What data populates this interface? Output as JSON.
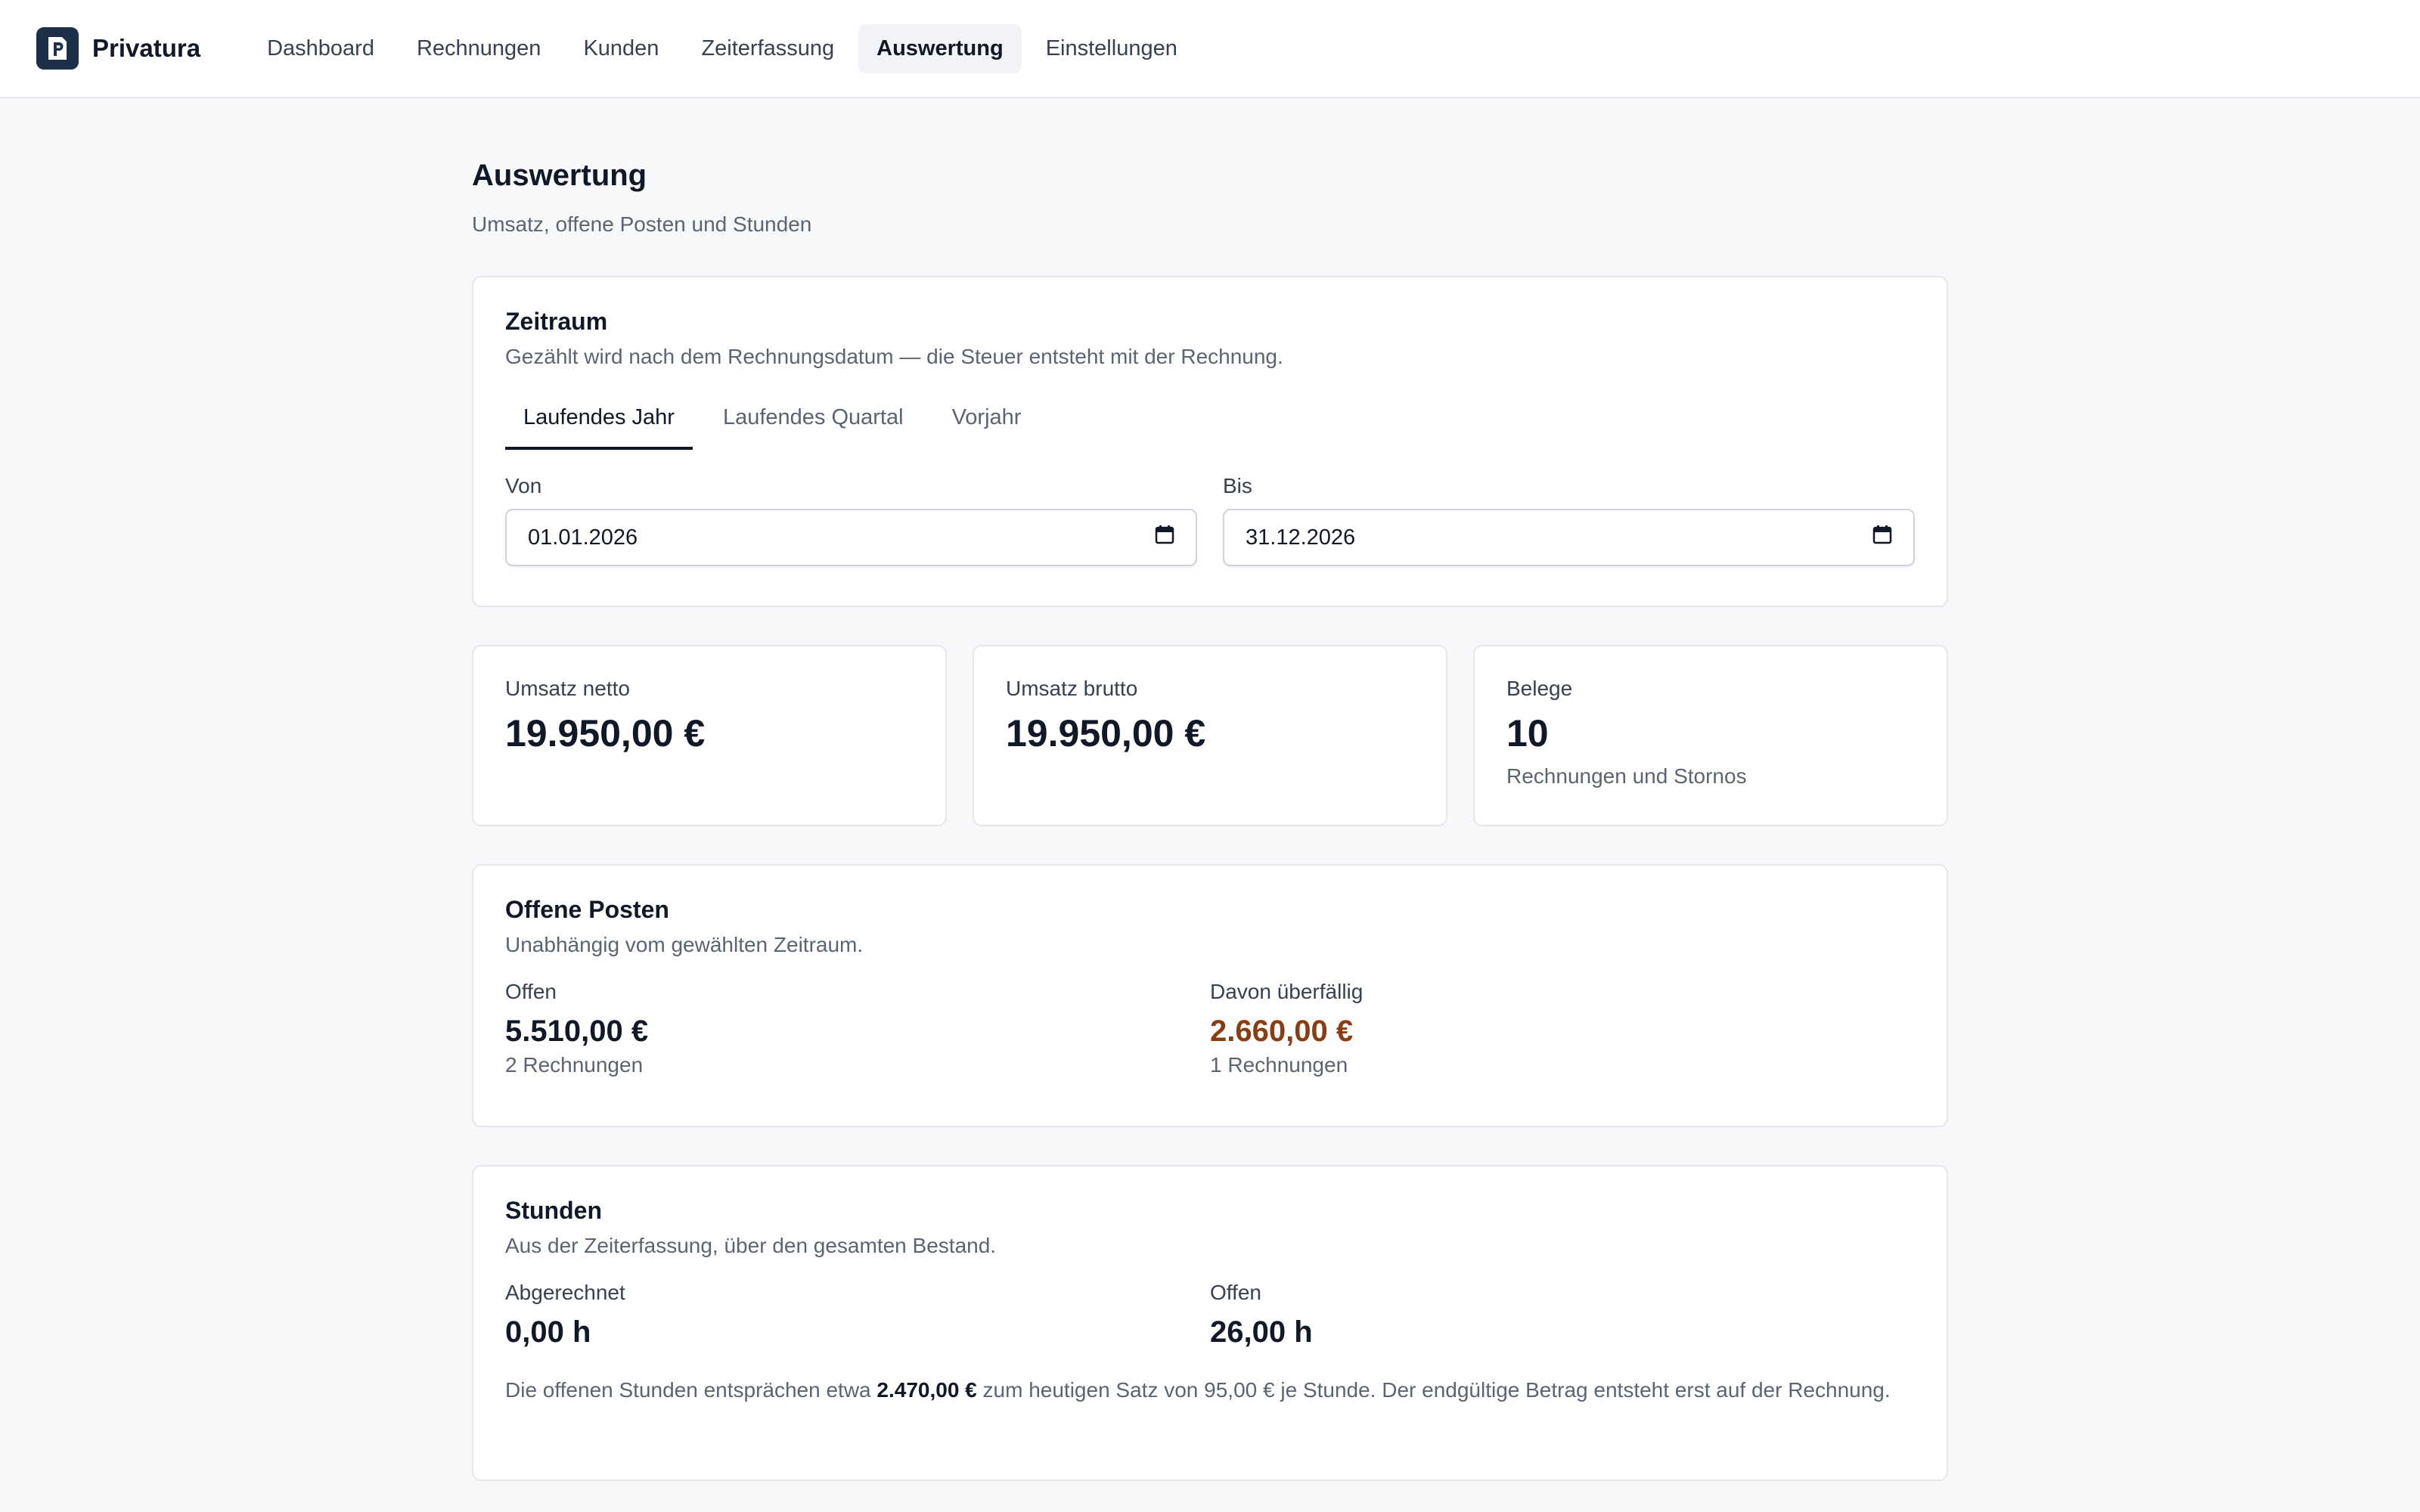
{
  "app": {
    "name": "Privatura",
    "logo_icon": "document-p-icon"
  },
  "nav": {
    "items": [
      {
        "label": "Dashboard",
        "active": false
      },
      {
        "label": "Rechnungen",
        "active": false
      },
      {
        "label": "Kunden",
        "active": false
      },
      {
        "label": "Zeiterfassung",
        "active": false
      },
      {
        "label": "Auswertung",
        "active": true
      },
      {
        "label": "Einstellungen",
        "active": false
      }
    ]
  },
  "page": {
    "title": "Auswertung",
    "subtitle": "Umsatz, offene Posten und Stunden"
  },
  "zeitraum": {
    "title": "Zeitraum",
    "subtitle": "Gezählt wird nach dem Rechnungsdatum — die Steuer entsteht mit der Rechnung.",
    "tabs": [
      {
        "label": "Laufendes Jahr",
        "active": true
      },
      {
        "label": "Laufendes Quartal",
        "active": false
      },
      {
        "label": "Vorjahr",
        "active": false
      }
    ],
    "von_label": "Von",
    "von_value": "01.01.2026",
    "bis_label": "Bis",
    "bis_value": "31.12.2026"
  },
  "stats": {
    "netto": {
      "label": "Umsatz netto",
      "value": "19.950,00 €"
    },
    "brutto": {
      "label": "Umsatz brutto",
      "value": "19.950,00 €"
    },
    "belege": {
      "label": "Belege",
      "value": "10",
      "note": "Rechnungen und Stornos"
    }
  },
  "offene_posten": {
    "title": "Offene Posten",
    "subtitle": "Unabhängig vom gewählten Zeitraum.",
    "offen_label": "Offen",
    "offen_value": "5.510,00 €",
    "offen_note": "2 Rechnungen",
    "ueberfaellig_label": "Davon überfällig",
    "ueberfaellig_value": "2.660,00 €",
    "ueberfaellig_note": "1 Rechnungen",
    "overdue_color": "#8a3d12"
  },
  "stunden": {
    "title": "Stunden",
    "subtitle": "Aus der Zeiterfassung, über den gesamten Bestand.",
    "abgerechnet_label": "Abgerechnet",
    "abgerechnet_value": "0,00 h",
    "offen_label": "Offen",
    "offen_value": "26,00 h",
    "note_pre": "Die offenen Stunden entsprächen etwa ",
    "note_amount": "2.470,00 €",
    "note_post": " zum heutigen Satz von 95,00 € je Stunde. Der endgültige Betrag entsteht erst auf der Rechnung."
  }
}
